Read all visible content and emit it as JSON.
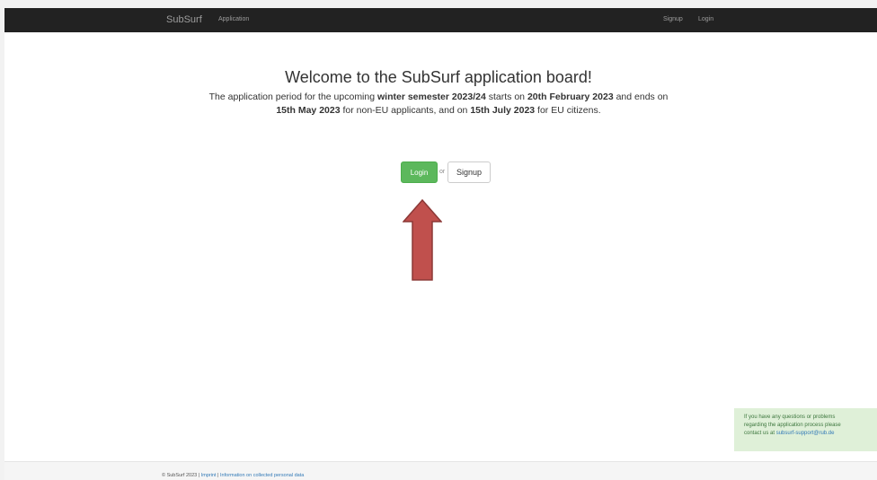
{
  "navbar": {
    "brand": "SubSurf",
    "application_link": "Application",
    "signup_link": "Signup",
    "login_link": "Login"
  },
  "main": {
    "heading": "Welcome to the SubSurf application board!",
    "intro": {
      "part1": "The application period for the upcoming ",
      "bold1": "winter semester 2023/24",
      "part2": " starts on ",
      "bold2": "20th February 2023",
      "part3": " and ends on ",
      "bold3": "15th May 2023",
      "part4": " for non-EU applicants, and on ",
      "bold4": "15th July 2023",
      "part5": " for EU citizens."
    },
    "login_button": "Login",
    "or_text": "or",
    "signup_button": "Signup"
  },
  "help_box": {
    "line1": "If you have any questions or problems",
    "line2": "regarding the application process please",
    "line3_prefix": "contact us at ",
    "email": "subsurf-support@rub.de"
  },
  "footer": {
    "copyright": "© SubSurf 2023 | ",
    "imprint": "Imprint",
    "separator": " | ",
    "privacy": "Information on collected personal data"
  },
  "colors": {
    "navbar_bg": "#222222",
    "login_button_bg": "#5cb85c",
    "arrow_fill": "#c0504d",
    "help_box_bg": "#dff0d8",
    "link": "#337ab7"
  },
  "icons": {
    "annotation_arrow": "up-arrow-icon"
  }
}
